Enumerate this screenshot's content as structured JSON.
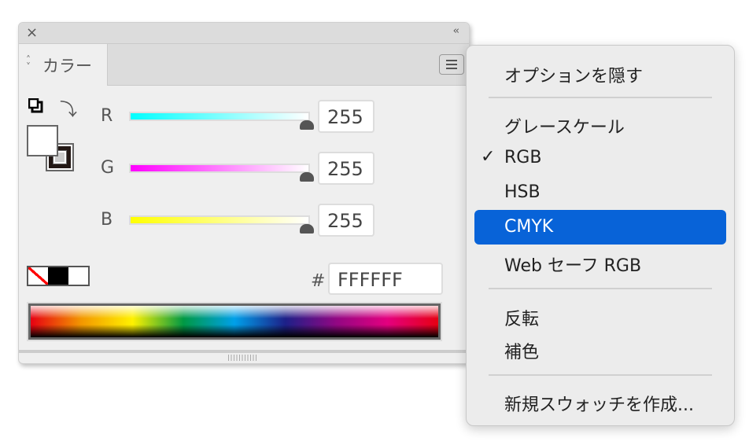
{
  "panel": {
    "close_icon": "×",
    "collapse_icon": "‹‹",
    "tab_label": "カラー",
    "channels": [
      {
        "label": "R",
        "value": "255",
        "gradient": [
          "#00ffff",
          "#ffffff"
        ]
      },
      {
        "label": "G",
        "value": "255",
        "gradient": [
          "#ff00ff",
          "#ffffff"
        ]
      },
      {
        "label": "B",
        "value": "255",
        "gradient": [
          "#ffff00",
          "#ffffff"
        ]
      }
    ],
    "hash_label": "#",
    "hex_value": "FFFFFF"
  },
  "menu": {
    "items": [
      {
        "label": "オプションを隠す"
      },
      {
        "label": "グレースケール"
      },
      {
        "label": "RGB",
        "checked": true,
        "check": "✓"
      },
      {
        "label": "HSB"
      },
      {
        "label": "CMYK",
        "highlighted": true
      },
      {
        "label": "Web セーフ RGB"
      },
      {
        "label": "反転"
      },
      {
        "label": "補色"
      },
      {
        "label": "新規スウォッチを作成..."
      }
    ]
  }
}
